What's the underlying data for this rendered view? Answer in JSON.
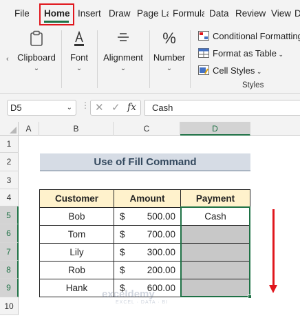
{
  "tabs": [
    "File",
    "Home",
    "Insert",
    "Draw",
    "Page La",
    "Formula",
    "Data",
    "Review",
    "View",
    "D"
  ],
  "active_tab": "Home",
  "ribbon": {
    "groups": [
      {
        "label": "Clipboard",
        "icon": "clipboard-icon"
      },
      {
        "label": "Font",
        "icon": "font-color-icon"
      },
      {
        "label": "Alignment",
        "icon": "align-icon"
      },
      {
        "label": "Number",
        "icon": "percent-icon"
      }
    ],
    "styles": {
      "conditional_formatting": "Conditional Formatting",
      "format_as_table": "Format as Table",
      "cell_styles": "Cell Styles",
      "group_label": "Styles"
    }
  },
  "formula_bar": {
    "name_box": "D5",
    "cancel_glyph": "✕",
    "confirm_glyph": "✓",
    "fx_glyph": "fx",
    "content": "Cash"
  },
  "columns": [
    "A",
    "B",
    "C",
    "D"
  ],
  "selected_column": "D",
  "rows": [
    "1",
    "2",
    "3",
    "4",
    "5",
    "6",
    "7",
    "8",
    "9",
    "10"
  ],
  "selected_rows": [
    "5",
    "6",
    "7",
    "8",
    "9"
  ],
  "sheet": {
    "title": "Use of Fill Command",
    "headers": [
      "Customer",
      "Amount",
      "Payment"
    ],
    "currency_symbol": "$",
    "records": [
      {
        "customer": "Bob",
        "amount": "500.00",
        "payment": "Cash"
      },
      {
        "customer": "Tom",
        "amount": "700.00",
        "payment": ""
      },
      {
        "customer": "Lily",
        "amount": "300.00",
        "payment": ""
      },
      {
        "customer": "Rob",
        "amount": "200.00",
        "payment": ""
      },
      {
        "customer": "Hank",
        "amount": "600.00",
        "payment": ""
      }
    ]
  },
  "watermark": {
    "name": "exceldemy",
    "tagline": "EXCEL · DATA · BI"
  },
  "colors": {
    "accent_green": "#1e7145",
    "highlight_red": "#e0161d",
    "header_fill": "#fff2cc",
    "title_fill": "#d6dce5",
    "filled_cell": "#c8c8c8"
  }
}
